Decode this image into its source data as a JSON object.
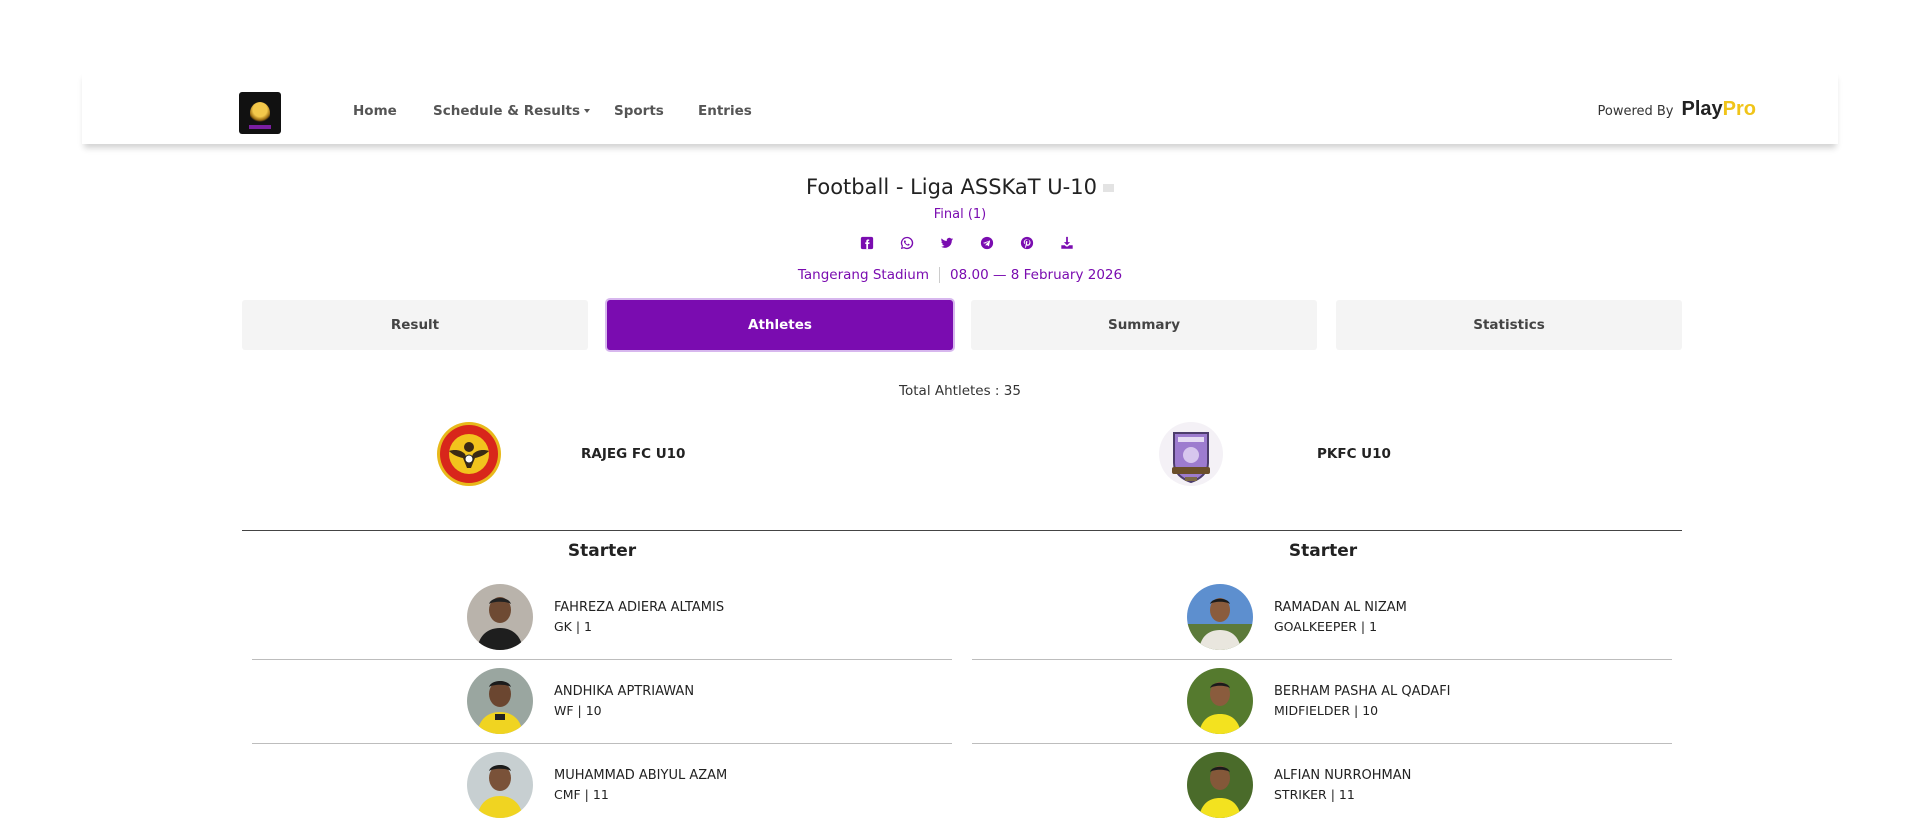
{
  "nav": {
    "links": [
      "Home",
      "Schedule & Results",
      "Sports",
      "Entries"
    ],
    "powered_by": "Powered By",
    "brand_play": "Play",
    "brand_pro": "Pro"
  },
  "match": {
    "title": "Football - Liga ASSKaT U-10",
    "stage": "Final (1)",
    "venue": "Tangerang Stadium",
    "datetime": "08.00 — 8 February 2026",
    "share_icons": [
      "facebook-icon",
      "whatsapp-icon",
      "twitter-icon",
      "telegram-icon",
      "pinterest-icon",
      "download-icon"
    ]
  },
  "tabs": [
    "Result",
    "Athletes",
    "Summary",
    "Statistics"
  ],
  "active_tab": "Athletes",
  "total_athletes": "Total Ahtletes : 35",
  "teams": {
    "home": {
      "name": "RAJEG FC U10",
      "section": "Starter",
      "players": [
        {
          "name": "FAHREZA ADIERA ALTAMIS",
          "meta": "GK | 1"
        },
        {
          "name": "ANDHIKA APTRIAWAN",
          "meta": "WF | 10"
        },
        {
          "name": "MUHAMMAD ABIYUL AZAM",
          "meta": "CMF | 11"
        }
      ]
    },
    "away": {
      "name": "PKFC U10",
      "section": "Starter",
      "players": [
        {
          "name": "RAMADAN AL NIZAM",
          "meta": "GOALKEEPER | 1"
        },
        {
          "name": "BERHAM PASHA AL QADAFI",
          "meta": "MIDFIELDER | 10"
        },
        {
          "name": "ALFIAN NURROHMAN",
          "meta": "STRIKER | 11"
        }
      ]
    }
  },
  "colors": {
    "accent": "#7a0cb0",
    "brand_pro": "#f0c419"
  }
}
